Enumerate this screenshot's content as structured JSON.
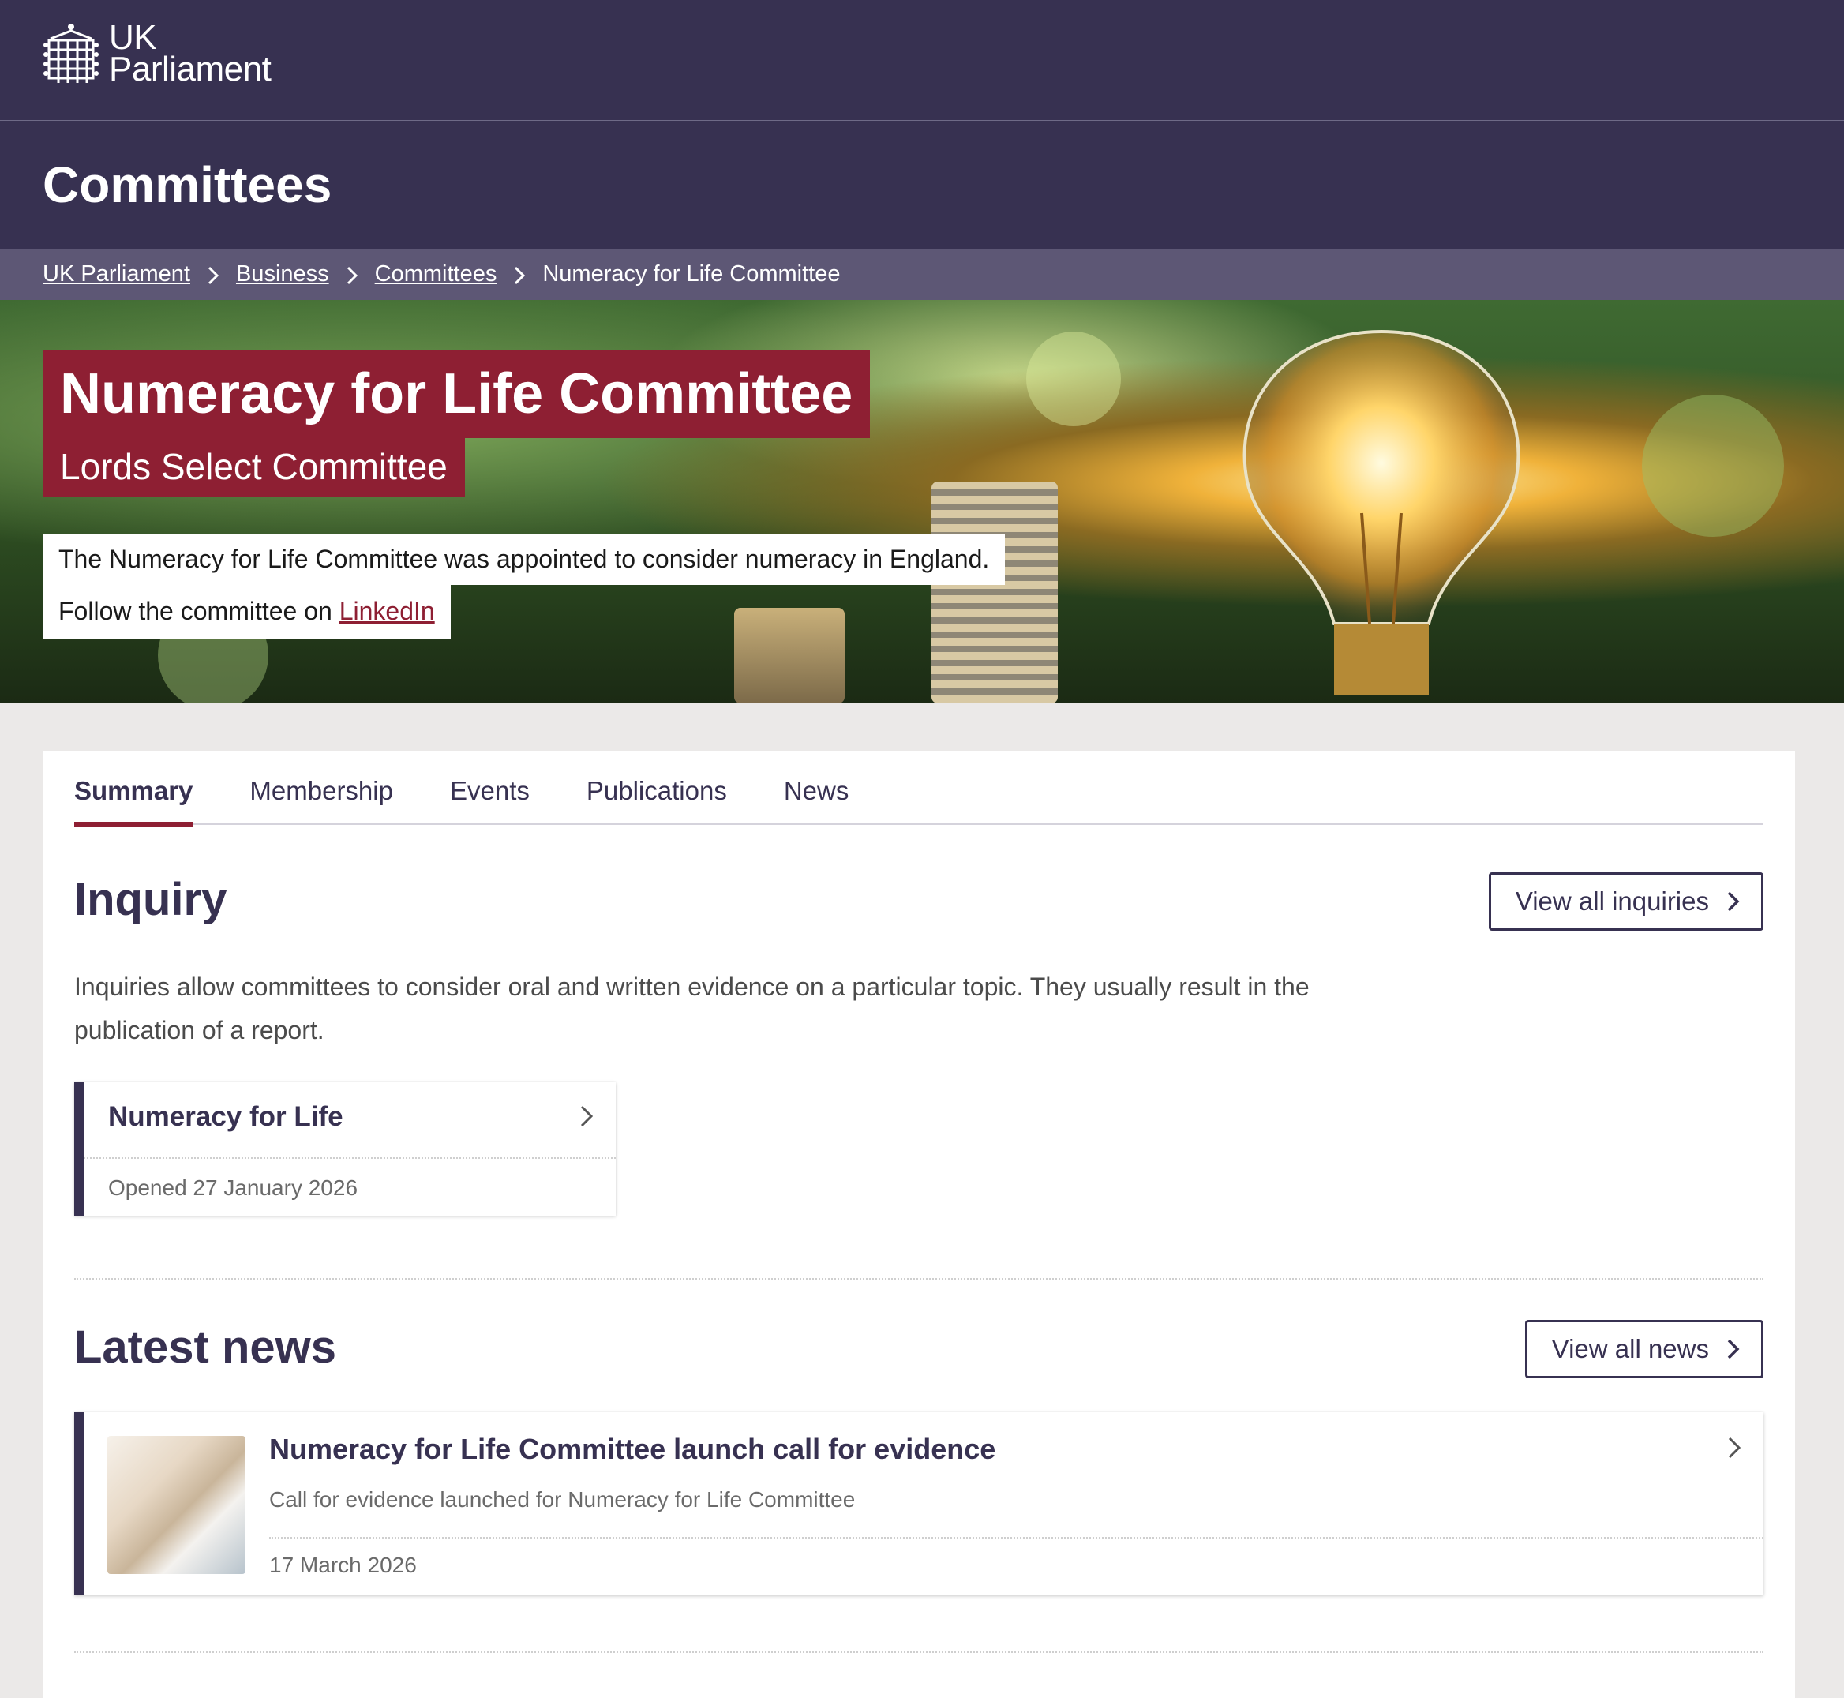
{
  "header": {
    "logo_line1": "UK",
    "logo_line2": "Parliament",
    "section_title": "Committees"
  },
  "breadcrumb": {
    "items": [
      "UK Parliament",
      "Business",
      "Committees"
    ],
    "current": "Numeracy for Life Committee"
  },
  "hero": {
    "title": "Numeracy for Life Committee",
    "subtitle": "Lords Select Committee",
    "description": "The Numeracy for Life Committee was appointed to consider numeracy in England.",
    "follow_prefix": "Follow the committee on ",
    "follow_link": "LinkedIn"
  },
  "tabs": [
    "Summary",
    "Membership",
    "Events",
    "Publications",
    "News"
  ],
  "active_tab": "Summary",
  "inquiry": {
    "heading": "Inquiry",
    "view_all_label": "View all inquiries",
    "intro": "Inquiries allow committees to consider oral and written evidence on a particular topic. They usually result in the publication of a report.",
    "card": {
      "title": "Numeracy for Life",
      "date": "Opened 27 January 2026"
    }
  },
  "news": {
    "heading": "Latest news",
    "view_all_label": "View all news",
    "card": {
      "title": "Numeracy for Life Committee launch call for evidence",
      "description": "Call for evidence launched for Numeracy for Life Committee",
      "date": "17 March 2026"
    }
  },
  "colors": {
    "brand_purple": "#373151",
    "breadcrumb_bg": "#5d5775",
    "lords_red": "#8e1f33",
    "page_bg": "#ebe9e8"
  }
}
